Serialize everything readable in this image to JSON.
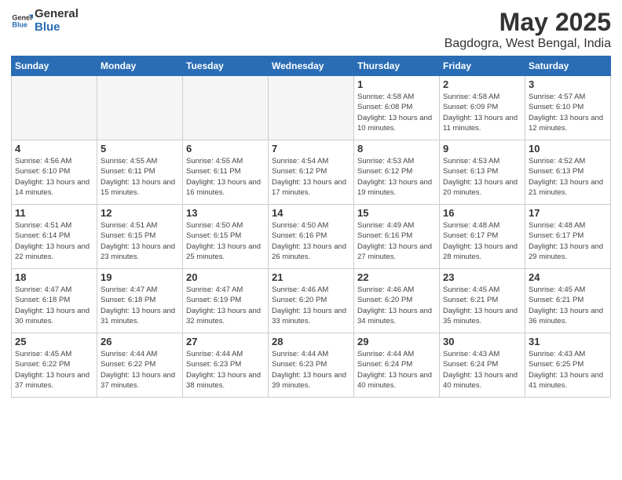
{
  "logo": {
    "general": "General",
    "blue": "Blue"
  },
  "title": "May 2025",
  "subtitle": "Bagdogra, West Bengal, India",
  "headers": [
    "Sunday",
    "Monday",
    "Tuesday",
    "Wednesday",
    "Thursday",
    "Friday",
    "Saturday"
  ],
  "weeks": [
    [
      {
        "day": "",
        "info": ""
      },
      {
        "day": "",
        "info": ""
      },
      {
        "day": "",
        "info": ""
      },
      {
        "day": "",
        "info": ""
      },
      {
        "day": "1",
        "info": "Sunrise: 4:58 AM\nSunset: 6:08 PM\nDaylight: 13 hours and 10 minutes."
      },
      {
        "day": "2",
        "info": "Sunrise: 4:58 AM\nSunset: 6:09 PM\nDaylight: 13 hours and 11 minutes."
      },
      {
        "day": "3",
        "info": "Sunrise: 4:57 AM\nSunset: 6:10 PM\nDaylight: 13 hours and 12 minutes."
      }
    ],
    [
      {
        "day": "4",
        "info": "Sunrise: 4:56 AM\nSunset: 6:10 PM\nDaylight: 13 hours and 14 minutes."
      },
      {
        "day": "5",
        "info": "Sunrise: 4:55 AM\nSunset: 6:11 PM\nDaylight: 13 hours and 15 minutes."
      },
      {
        "day": "6",
        "info": "Sunrise: 4:55 AM\nSunset: 6:11 PM\nDaylight: 13 hours and 16 minutes."
      },
      {
        "day": "7",
        "info": "Sunrise: 4:54 AM\nSunset: 6:12 PM\nDaylight: 13 hours and 17 minutes."
      },
      {
        "day": "8",
        "info": "Sunrise: 4:53 AM\nSunset: 6:12 PM\nDaylight: 13 hours and 19 minutes."
      },
      {
        "day": "9",
        "info": "Sunrise: 4:53 AM\nSunset: 6:13 PM\nDaylight: 13 hours and 20 minutes."
      },
      {
        "day": "10",
        "info": "Sunrise: 4:52 AM\nSunset: 6:13 PM\nDaylight: 13 hours and 21 minutes."
      }
    ],
    [
      {
        "day": "11",
        "info": "Sunrise: 4:51 AM\nSunset: 6:14 PM\nDaylight: 13 hours and 22 minutes."
      },
      {
        "day": "12",
        "info": "Sunrise: 4:51 AM\nSunset: 6:15 PM\nDaylight: 13 hours and 23 minutes."
      },
      {
        "day": "13",
        "info": "Sunrise: 4:50 AM\nSunset: 6:15 PM\nDaylight: 13 hours and 25 minutes."
      },
      {
        "day": "14",
        "info": "Sunrise: 4:50 AM\nSunset: 6:16 PM\nDaylight: 13 hours and 26 minutes."
      },
      {
        "day": "15",
        "info": "Sunrise: 4:49 AM\nSunset: 6:16 PM\nDaylight: 13 hours and 27 minutes."
      },
      {
        "day": "16",
        "info": "Sunrise: 4:48 AM\nSunset: 6:17 PM\nDaylight: 13 hours and 28 minutes."
      },
      {
        "day": "17",
        "info": "Sunrise: 4:48 AM\nSunset: 6:17 PM\nDaylight: 13 hours and 29 minutes."
      }
    ],
    [
      {
        "day": "18",
        "info": "Sunrise: 4:47 AM\nSunset: 6:18 PM\nDaylight: 13 hours and 30 minutes."
      },
      {
        "day": "19",
        "info": "Sunrise: 4:47 AM\nSunset: 6:18 PM\nDaylight: 13 hours and 31 minutes."
      },
      {
        "day": "20",
        "info": "Sunrise: 4:47 AM\nSunset: 6:19 PM\nDaylight: 13 hours and 32 minutes."
      },
      {
        "day": "21",
        "info": "Sunrise: 4:46 AM\nSunset: 6:20 PM\nDaylight: 13 hours and 33 minutes."
      },
      {
        "day": "22",
        "info": "Sunrise: 4:46 AM\nSunset: 6:20 PM\nDaylight: 13 hours and 34 minutes."
      },
      {
        "day": "23",
        "info": "Sunrise: 4:45 AM\nSunset: 6:21 PM\nDaylight: 13 hours and 35 minutes."
      },
      {
        "day": "24",
        "info": "Sunrise: 4:45 AM\nSunset: 6:21 PM\nDaylight: 13 hours and 36 minutes."
      }
    ],
    [
      {
        "day": "25",
        "info": "Sunrise: 4:45 AM\nSunset: 6:22 PM\nDaylight: 13 hours and 37 minutes."
      },
      {
        "day": "26",
        "info": "Sunrise: 4:44 AM\nSunset: 6:22 PM\nDaylight: 13 hours and 37 minutes."
      },
      {
        "day": "27",
        "info": "Sunrise: 4:44 AM\nSunset: 6:23 PM\nDaylight: 13 hours and 38 minutes."
      },
      {
        "day": "28",
        "info": "Sunrise: 4:44 AM\nSunset: 6:23 PM\nDaylight: 13 hours and 39 minutes."
      },
      {
        "day": "29",
        "info": "Sunrise: 4:44 AM\nSunset: 6:24 PM\nDaylight: 13 hours and 40 minutes."
      },
      {
        "day": "30",
        "info": "Sunrise: 4:43 AM\nSunset: 6:24 PM\nDaylight: 13 hours and 40 minutes."
      },
      {
        "day": "31",
        "info": "Sunrise: 4:43 AM\nSunset: 6:25 PM\nDaylight: 13 hours and 41 minutes."
      }
    ]
  ]
}
